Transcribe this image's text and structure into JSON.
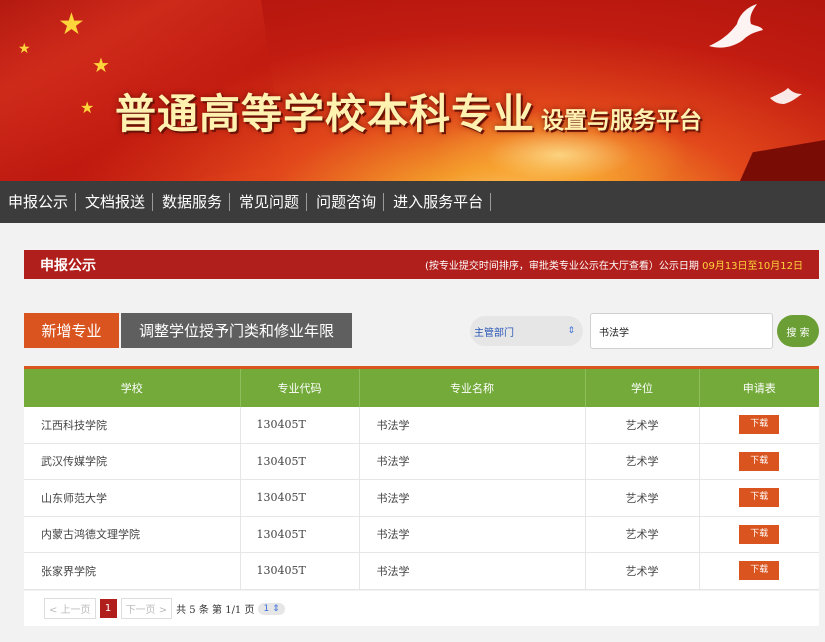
{
  "banner": {
    "title_main": "普通高等学校本科专业",
    "title_sub": "设置与服务平台"
  },
  "nav": {
    "items": [
      "申报公示",
      "文档报送",
      "数据服务",
      "常见问题",
      "问题咨询",
      "进入服务平台"
    ]
  },
  "section": {
    "title": "申报公示",
    "note_prefix": "(按专业提交时间排序，审批类专业公示在大厅查看）公示日期",
    "note_date": "09月13日至10月12日"
  },
  "tabs": {
    "new_major": "新增专业",
    "adjust": "调整学位授予门类和修业年限"
  },
  "filters": {
    "department": "主管部门",
    "search_value": "书法学",
    "search_button": "搜 索"
  },
  "table": {
    "headers": [
      "学校",
      "专业代码",
      "专业名称",
      "学位",
      "申请表"
    ],
    "rows": [
      {
        "school": "江西科技学院",
        "code": "130405T",
        "name": "书法学",
        "degree": "艺术学",
        "action": "下载"
      },
      {
        "school": "武汉传媒学院",
        "code": "130405T",
        "name": "书法学",
        "degree": "艺术学",
        "action": "下载"
      },
      {
        "school": "山东师范大学",
        "code": "130405T",
        "name": "书法学",
        "degree": "艺术学",
        "action": "下载"
      },
      {
        "school": "内蒙古鸿德文理学院",
        "code": "130405T",
        "name": "书法学",
        "degree": "艺术学",
        "action": "下载"
      },
      {
        "school": "张家界学院",
        "code": "130405T",
        "name": "书法学",
        "degree": "艺术学",
        "action": "下载"
      }
    ]
  },
  "pagination": {
    "prev": "< 上一页",
    "current": "1",
    "next": "下一页 >",
    "info": "共 5 条 第 1/1 页",
    "page_select": "1"
  },
  "colors": {
    "banner_red": "#c21c11",
    "nav_bg": "#3c3c3c",
    "section_red": "#b01f1b",
    "accent_orange": "#d9541e",
    "table_green": "#73aa3a"
  }
}
